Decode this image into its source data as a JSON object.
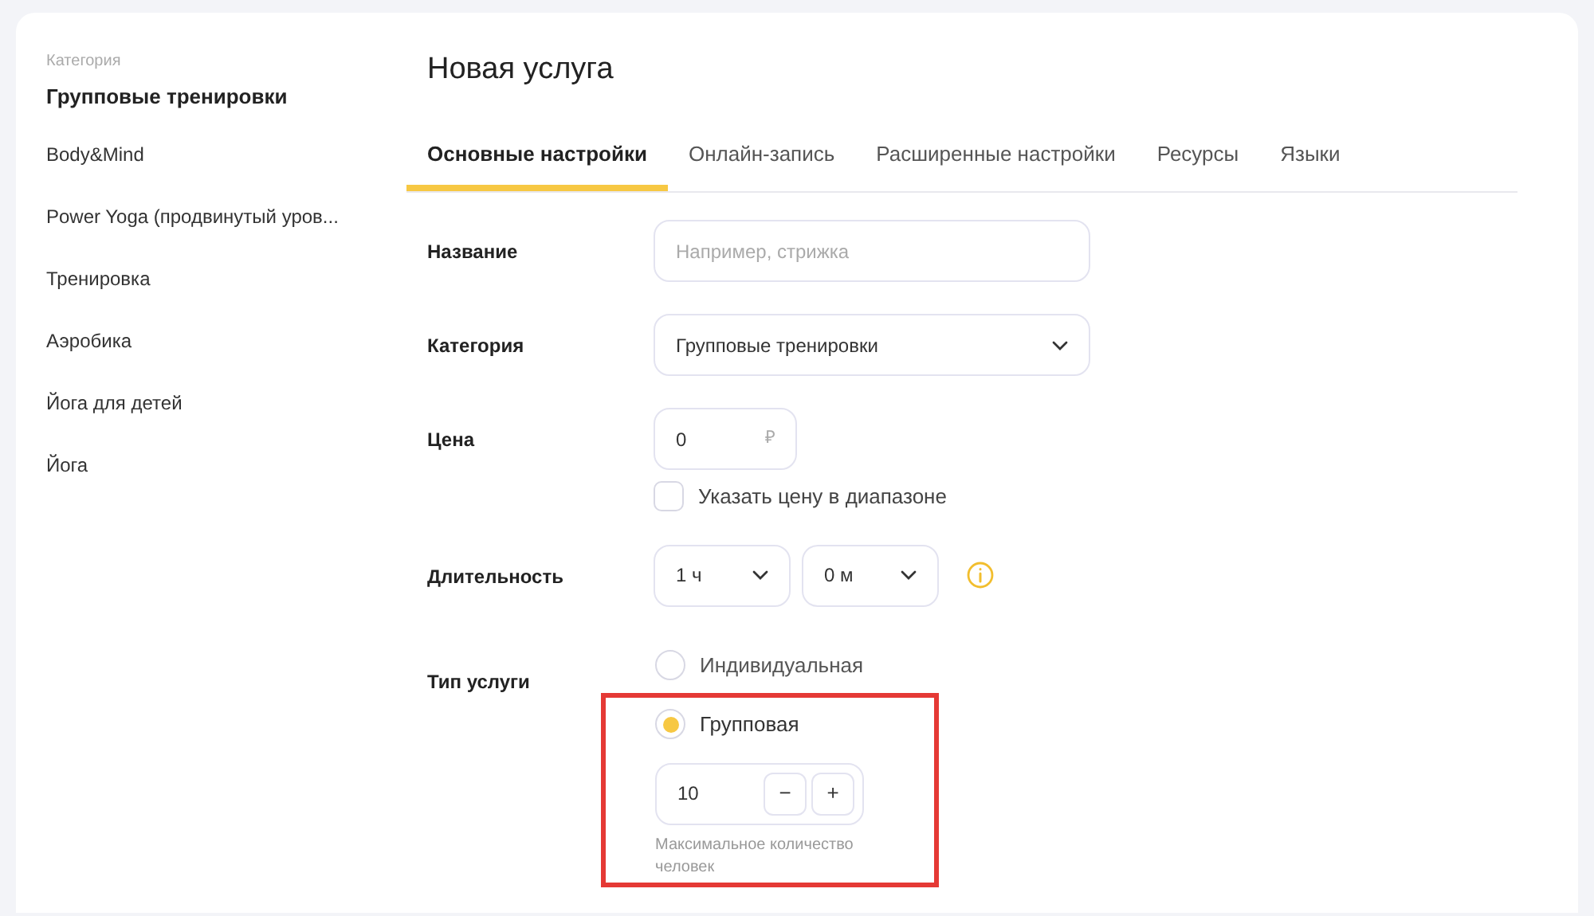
{
  "sidebar": {
    "label": "Категория",
    "title": "Групповые тренировки",
    "items": [
      {
        "label": "Body&Mind"
      },
      {
        "label": "Power Yoga (продвинутый уров..."
      },
      {
        "label": "Тренировка"
      },
      {
        "label": "Аэробика"
      },
      {
        "label": "Йога для детей"
      },
      {
        "label": "Йога"
      }
    ]
  },
  "page_title": "Новая услуга",
  "tabs": [
    {
      "label": "Основные настройки",
      "selected": true
    },
    {
      "label": "Онлайн-запись",
      "selected": false
    },
    {
      "label": "Расширенные настройки",
      "selected": false
    },
    {
      "label": "Ресурсы",
      "selected": false
    },
    {
      "label": "Языки",
      "selected": false
    }
  ],
  "form": {
    "name": {
      "label": "Название",
      "placeholder": "Например, стрижка"
    },
    "category": {
      "label": "Категория",
      "value": "Групповые тренировки"
    },
    "price": {
      "label": "Цена",
      "value": "0",
      "currency": "₽",
      "range_checkbox": {
        "label": "Указать цену в диапазоне",
        "checked": false
      }
    },
    "duration": {
      "label": "Длительность",
      "hours": "1 ч",
      "minutes": "0 м"
    },
    "service_type": {
      "label": "Тип услуги",
      "options": [
        {
          "label": "Индивидуальная",
          "selected": false,
          "highlighted": false
        },
        {
          "label": "Групповая",
          "selected": true,
          "highlighted": true,
          "capacity": {
            "value": "10",
            "minus": "−",
            "plus": "+",
            "hint": "Максимальное количество человек"
          }
        }
      ]
    }
  }
}
